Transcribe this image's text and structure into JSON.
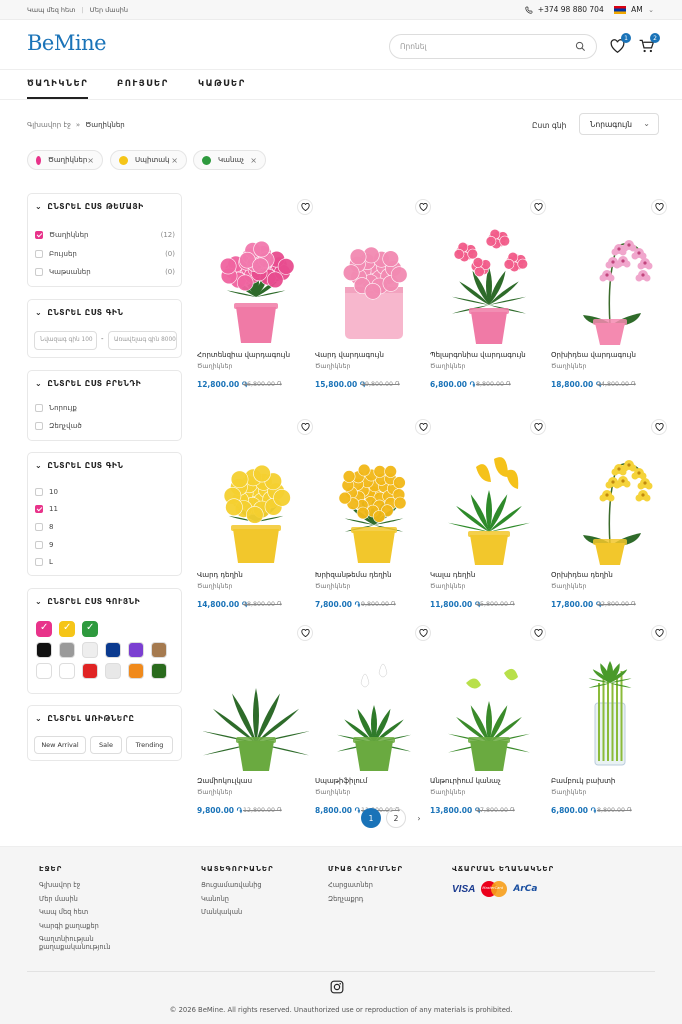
{
  "topbar": {
    "contact": "Կապ մեզ հետ",
    "about": "Մեր մասին",
    "phone": "+374 98 880 704",
    "lang": "AM"
  },
  "header": {
    "logo": "BeMine",
    "search_placeholder": "Որոնել",
    "wishlist_count": "1",
    "cart_count": "2"
  },
  "nav": [
    "ԾԱՂԻԿՆԵՐ",
    "ԲՈՒՅՍԵՐ",
    "ԿԱԹՍԵՐ"
  ],
  "breadcrumb": {
    "home": "Գլխավոր էջ",
    "current": "Ծաղիկներ"
  },
  "sort": {
    "label": "Ըստ գնի",
    "value": "Նորագույն"
  },
  "chips": [
    {
      "label": "Ծաղիկներ",
      "color": "#e8338a"
    },
    {
      "label": "Սպիտակ",
      "color": "#f5c518"
    },
    {
      "label": "Կանաչ",
      "color": "#2e9a3e"
    }
  ],
  "filters": {
    "topic": {
      "title": "ԸՆՏՐԵԼ ԸՍՏ ԹԵՄԱՅԻ",
      "items": [
        {
          "label": "Ծաղիկներ",
          "count": "(12)"
        },
        {
          "label": "Բույսեր",
          "count": "(0)"
        },
        {
          "label": "Կաթսաներ",
          "count": "(0)"
        }
      ]
    },
    "price": {
      "title": "ԸՆՏՐԵԼ ԸՍՏ ԳԻՆ",
      "min": "Նվազագ գին 100",
      "max": "Առավելագ գին 80000"
    },
    "size": {
      "title": "ԸՆՏՐԵԼ ԸՍՏ ԲՐԵՆԴԻ",
      "items": [
        "Նորույք",
        "Զեղչված"
      ]
    },
    "count": {
      "title": "ԸՆՏՐԵԼ ԸՍՏ ԳԻՆ",
      "items": [
        "10",
        "11",
        "8",
        "9",
        "L"
      ]
    },
    "color": {
      "title": "ԸՆՏՐԵԼ ԸՍՏ ԳՈՒՅՆԻ",
      "swatches": [
        "#e8338a",
        "#f5c518",
        "#2e9a3e",
        "#111111",
        "#9a9a9a",
        "#eeeeee",
        "#0b3a8f",
        "#7b3fd1",
        "#a57a4f",
        "#ffffff",
        "#ffffff",
        "#e02424",
        "#e8e8e8",
        "#f08a1c",
        "#2a6b1d"
      ]
    },
    "occasion": {
      "title": "ԸՆՏՐԵԼ ԱՌԻԹՆԵՐԸ",
      "items": [
        "New Arrival",
        "Sale",
        "Trending"
      ]
    }
  },
  "products": [
    {
      "name": "Հորտենզիա վարդագույն",
      "cat": "Ծաղիկներ",
      "price": "12,800.00 ֏",
      "old": "16,800.00 ֏",
      "type": "hydrangea"
    },
    {
      "name": "Վարդ վարդագույն",
      "cat": "Ծաղիկներ",
      "price": "15,800.00 ֏",
      "old": "19,800.00 ֏",
      "type": "rosebox"
    },
    {
      "name": "Պելարգոնիա վարդագույն",
      "cat": "Ծաղիկներ",
      "price": "6,800.00 ֏",
      "old": "8,800.00 ֏",
      "type": "geranium"
    },
    {
      "name": "Օրխիդեա վարդագույն",
      "cat": "Ծաղիկներ",
      "price": "18,800.00 ֏",
      "old": "24,800.00 ֏",
      "type": "orchidpink"
    },
    {
      "name": "Վարդ դեղին",
      "cat": "Ծաղիկներ",
      "price": "14,800.00 ֏",
      "old": "18,800.00 ֏",
      "type": "roseyellow"
    },
    {
      "name": "Խրիզանթեմա դեղին",
      "cat": "Ծաղիկներ",
      "price": "7,800.00 ֏",
      "old": "9,800.00 ֏",
      "type": "chrys"
    },
    {
      "name": "Կալա դեղին",
      "cat": "Ծաղիկներ",
      "price": "11,800.00 ֏",
      "old": "15,800.00 ֏",
      "type": "calla"
    },
    {
      "name": "Օրխիդեա դեղին",
      "cat": "Ծաղիկներ",
      "price": "17,800.00 ֏",
      "old": "22,800.00 ֏",
      "type": "orchidyellow"
    },
    {
      "name": "Զամիոկուլկաս",
      "cat": "Ծաղիկներ",
      "price": "9,800.00 ֏",
      "old": "12,800.00 ֏",
      "type": "zz"
    },
    {
      "name": "Սպաթիֆիլում",
      "cat": "Ծաղիկներ",
      "price": "8,800.00 ֏",
      "old": "11,800.00 ֏",
      "type": "spath"
    },
    {
      "name": "Անթուրիում կանաչ",
      "cat": "Ծաղիկներ",
      "price": "13,800.00 ֏",
      "old": "17,800.00 ֏",
      "type": "anth"
    },
    {
      "name": "Բամբուկ բախտի",
      "cat": "Ծաղիկներ",
      "price": "6,800.00 ֏",
      "old": "8,800.00 ֏",
      "type": "bamboo"
    }
  ],
  "pagination": [
    "1",
    "2",
    "›"
  ],
  "footer": {
    "pages": {
      "title": "ԷՋԵՐ",
      "items": [
        "Գլխավոր էջ",
        "Մեր մասին",
        "Կապ մեզ հետ",
        "Կարգի քաղաքեր",
        "Գաղտնիության քաղաքականություն"
      ]
    },
    "categories": {
      "title": "ԿԱՏԵԳՈՐԻԱՆԵՐ",
      "items": [
        "Ցուցամառվանից",
        "Կանոնը",
        "Մանկական"
      ]
    },
    "more": {
      "title": "ՄԻԱՑ ՀՂՈՒՄՆԵՐ",
      "items": [
        "Հարցատներ",
        "Զեղչաքրդ"
      ]
    },
    "payment": {
      "title": "ՎՃԱՐՄԱՆ ԵՂԱՆԱԿՆԵՐ",
      "items": [
        "VISA",
        "MasterCard",
        "ArCa"
      ]
    },
    "copyright": "© 2026 BeMine. All rights reserved. Unauthorized use or reproduction of any materials is prohibited."
  }
}
